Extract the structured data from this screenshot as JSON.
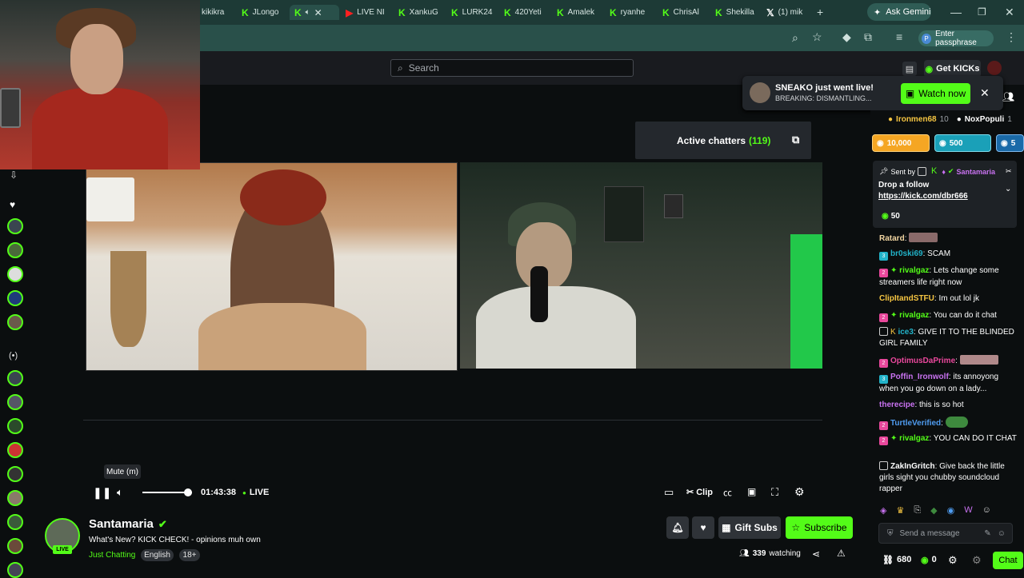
{
  "browser": {
    "tabs": [
      {
        "label": "kikikra",
        "icon": "kick-icon"
      },
      {
        "label": "JLongo",
        "icon": "kick-icon"
      },
      {
        "label": "",
        "icon": "kick-icon",
        "active": true
      },
      {
        "label": "LIVE NI",
        "icon": "youtube-icon"
      },
      {
        "label": "XankuG",
        "icon": "kick-icon"
      },
      {
        "label": "LURK24",
        "icon": "kick-icon"
      },
      {
        "label": "420Yeti",
        "icon": "kick-icon"
      },
      {
        "label": "Amalek",
        "icon": "kick-icon"
      },
      {
        "label": "ryanhe",
        "icon": "kick-icon"
      },
      {
        "label": "ChrisAl",
        "icon": "kick-icon"
      },
      {
        "label": "Shekilla",
        "icon": "kick-icon"
      },
      {
        "label": "(1) mik",
        "icon": "x-icon"
      }
    ],
    "gemini_label": "Ask Gemini",
    "passphrase_label": "Enter passphrase",
    "passphrase_badge": "P"
  },
  "header": {
    "search_placeholder": "Search",
    "get_kicks": "Get KICKs"
  },
  "notification": {
    "title": "SNEAKO just went live!",
    "subtitle": "BREAKING: DISMANTLING...",
    "button": "Watch now"
  },
  "player": {
    "active_chatters_label": "Active chatters",
    "active_chatters_count": "(119)",
    "tooltip": "Mute (m)",
    "time": "01:43:38",
    "live_label": "LIVE",
    "clip_label": "Clip",
    "volume_level": 0.92
  },
  "channel": {
    "name": "Santamaria",
    "title": "What's New? KICK CHECK! - opinions muh own",
    "category": "Just Chatting",
    "tags": [
      "English",
      "18+"
    ],
    "live_badge": "LIVE",
    "gift_subs": "Gift Subs",
    "subscribe": "Subscribe",
    "viewers": "339",
    "viewers_label": "watching"
  },
  "chat": {
    "gifters": [
      {
        "name": "Ironmen68",
        "count": "10"
      },
      {
        "name": "NoxPopuli",
        "count": "1"
      }
    ],
    "gift_boxes": [
      "10,000",
      "500",
      "5"
    ],
    "pinned": {
      "sent_by_label": "Sent by",
      "sender": "Santamaria",
      "message": "Drop a follow",
      "link": "https://kick.com/dbr666",
      "reward": "50"
    },
    "messages": [
      {
        "user": "Ratard",
        "text": ""
      },
      {
        "user": "br0ski69",
        "text": "SCAM",
        "color": "#22b3c9"
      },
      {
        "user": "rivalgaz",
        "text": "Lets change some streamers life right now",
        "color": "#53fc18"
      },
      {
        "user": "ClipItandSTFU",
        "text": "Im out lol jk",
        "color": "#f5c542"
      },
      {
        "user": "rivalgaz",
        "text": "You can do it chat",
        "color": "#53fc18"
      },
      {
        "user": "ice3",
        "text": "GIVE IT TO THE BLINDED GIRL FAMILY",
        "color": "#22b3c9"
      },
      {
        "user": "OptimusDaPrime",
        "text": "",
        "color": "#e9489c"
      },
      {
        "user": "Poffin_Ironwolf",
        "text": "its annoyong when you go down on a lady...",
        "color": "#c872f0"
      },
      {
        "user": "therecipe",
        "text": "this is so hot",
        "color": "#c872f0"
      },
      {
        "user": "TurtleVerified",
        "text": "",
        "color": "#4f9cf0"
      },
      {
        "user": "rivalgaz",
        "text": "YOU CAN DO IT CHAT",
        "color": "#53fc18"
      },
      {
        "user": "ZakInGritch",
        "text": "Give back the little girls sight you chubby soundcloud rapper",
        "color": "#ffffff"
      }
    ],
    "input_placeholder": "Send a message",
    "points": "680",
    "kicks": "0",
    "chat_button": "Chat"
  }
}
